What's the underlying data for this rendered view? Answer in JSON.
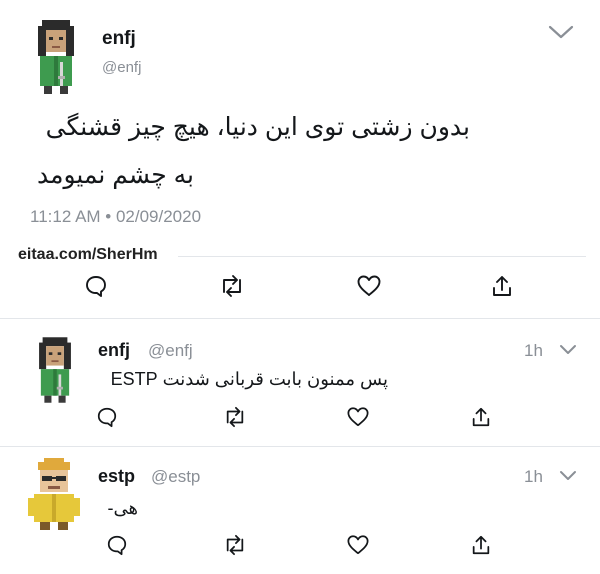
{
  "main_tweet": {
    "display_name": "enfj",
    "handle": "@enfj",
    "text_line1": "بدون زشتی توی این دنیا، هیچ چیز قشنگی",
    "text_line2": "به چشم نمیومد",
    "timestamp": "11:12 AM • 02/09/2020",
    "watermark": "eitaa.com/SherHm"
  },
  "replies": [
    {
      "display_name": "enfj",
      "handle": "@enfj",
      "time": "1h",
      "text": "پس ممنون بابت قربانی شدنت ESTP"
    },
    {
      "display_name": "estp",
      "handle": "@estp",
      "time": "1h",
      "text": "هی-"
    }
  ],
  "icons": {
    "reply": "speech-bubble-icon",
    "retweet": "retweet-arrows-icon",
    "like": "heart-icon",
    "share": "share-upload-icon",
    "menu": "chevron-down-icon"
  },
  "colors": {
    "text": "#14171a",
    "muted": "#8a8f96",
    "divider": "#e3e6ea"
  }
}
